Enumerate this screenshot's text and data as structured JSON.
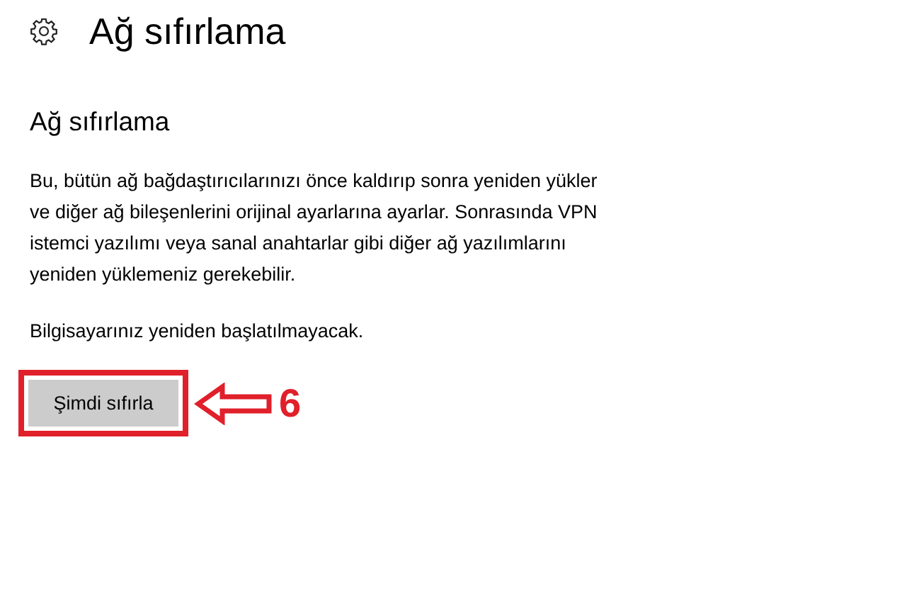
{
  "header": {
    "title": "Ağ sıfırlama"
  },
  "section": {
    "heading": "Ağ sıfırlama",
    "description_lines": [
      "Bu, bütün ağ bağdaştırıcılarınızı önce kaldırıp sonra yeniden yükler",
      "ve diğer ağ bileşenlerini orijinal ayarlarına ayarlar. Sonrasında VPN",
      "istemci yazılımı veya sanal anahtarlar gibi diğer ağ yazılımlarını",
      "yeniden yüklemeniz gerekebilir."
    ],
    "note": "Bilgisayarınız yeniden başlatılmayacak.",
    "button": "Şimdi sıfırla"
  },
  "annotation": {
    "number": "6"
  }
}
